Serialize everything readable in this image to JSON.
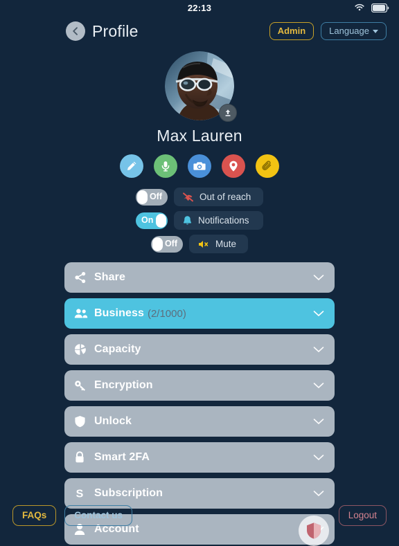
{
  "status_bar": {
    "time": "22:13",
    "wifi_icon": "wifi-icon",
    "battery_icon": "battery-icon"
  },
  "header": {
    "back_icon": "arrow-left-icon",
    "title": "Profile",
    "admin_label": "Admin",
    "language_label": "Language",
    "language_caret": "chevron-down-icon"
  },
  "profile": {
    "name": "Max Lauren",
    "avatar_alt": "swimmer-portrait",
    "upload_icon": "upload-icon"
  },
  "action_buttons": [
    {
      "name": "edit-button",
      "icon": "pencil-icon",
      "color": "#76c3e8"
    },
    {
      "name": "voice-button",
      "icon": "microphone-icon",
      "color": "#6cc077"
    },
    {
      "name": "camera-button",
      "icon": "camera-icon",
      "color": "#4a90d9"
    },
    {
      "name": "location-button",
      "icon": "map-pin-icon",
      "color": "#d9534f"
    },
    {
      "name": "attach-button",
      "icon": "paperclip-icon",
      "color": "#f2c313"
    }
  ],
  "toggles": [
    {
      "name": "out-of-reach",
      "state": "Off",
      "on": false,
      "label": "Out of reach",
      "icon": "signal-off-icon",
      "icon_color": "#d9534f"
    },
    {
      "name": "notifications",
      "state": "On",
      "on": true,
      "label": "Notifications",
      "icon": "bell-icon",
      "icon_color": "#4ec3e0"
    },
    {
      "name": "mute",
      "state": "Off",
      "on": false,
      "label": "Mute",
      "icon": "speaker-mute-icon",
      "icon_color": "#f2c313"
    }
  ],
  "list_rows": [
    {
      "name": "share",
      "label": "Share",
      "sub": "",
      "icon": "share-icon",
      "active": false
    },
    {
      "name": "business",
      "label": "Business",
      "sub": "(2/1000)",
      "icon": "users-icon",
      "active": true
    },
    {
      "name": "capacity",
      "label": "Capacity",
      "sub": "",
      "icon": "pie-chart-icon",
      "active": false
    },
    {
      "name": "encryption",
      "label": "Encryption",
      "sub": "",
      "icon": "key-icon",
      "active": false
    },
    {
      "name": "unlock",
      "label": "Unlock",
      "sub": "",
      "icon": "shield-icon",
      "active": false
    },
    {
      "name": "smart-2fa",
      "label": "Smart 2FA",
      "sub": "",
      "icon": "lock-icon",
      "active": false
    },
    {
      "name": "subscription",
      "label": "Subscription",
      "sub": "",
      "icon": "s-letter-icon",
      "active": false
    },
    {
      "name": "account",
      "label": "Account",
      "sub": "",
      "icon": "person-icon",
      "active": false
    }
  ],
  "floating_badge": {
    "icon": "shield-badge-icon",
    "color": "#c0646f"
  },
  "footer": {
    "faqs_label": "FAQs",
    "contact_label": "Contact us",
    "logout_label": "Logout"
  },
  "colors": {
    "background": "#12263c",
    "row": "#aab5c0",
    "row_active": "#4ec3e0",
    "chip": "#22384f",
    "accent_gold": "#e3b93f",
    "accent_blue": "#9fc4dc",
    "accent_red": "#d4838f"
  }
}
